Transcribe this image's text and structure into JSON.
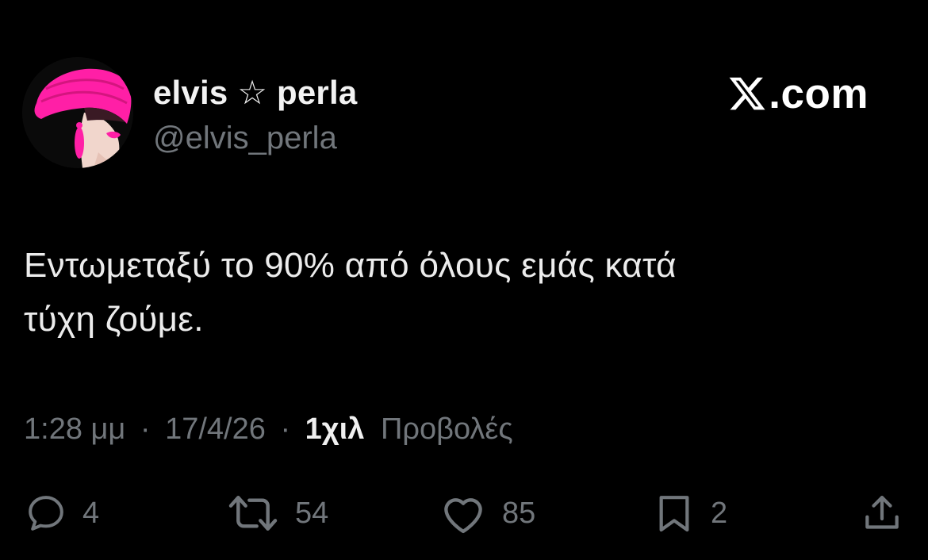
{
  "author": {
    "display_name": "elvis ☆ perla",
    "handle": "@elvis_perla",
    "avatar_icon": "woman-pink-hat-avatar"
  },
  "brand": {
    "icon": "x-logo-icon",
    "label": ".com"
  },
  "tweet": {
    "text_line1": "Εντωμεταξύ το 90% από όλους εμάς κατά",
    "text_line2": "τύχη ζούμε."
  },
  "meta": {
    "time": "1:28 μμ",
    "date": "17/4/26",
    "separator": "·",
    "views_count": "1χιλ",
    "views_label": "Προβολές"
  },
  "actions": {
    "replies": "4",
    "reposts": "54",
    "likes": "85",
    "bookmarks": "2"
  },
  "colors": {
    "background": "#000000",
    "text": "#e7e9ea",
    "muted": "#71767b",
    "accent_pink": "#ff1fa6"
  }
}
